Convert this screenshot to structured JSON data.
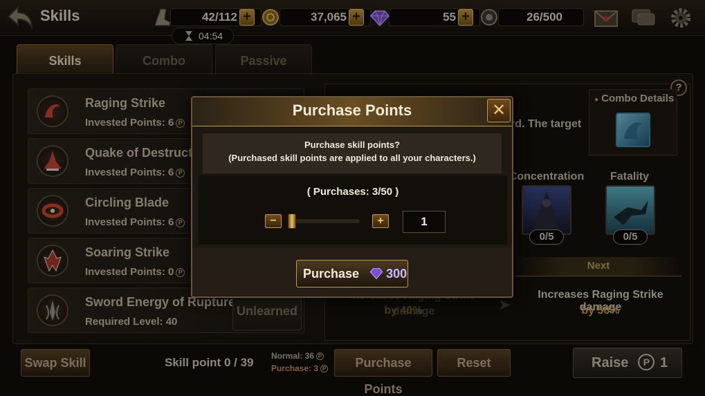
{
  "header": {
    "title": "Skills",
    "stamina": "42/112",
    "gold": "37,065",
    "gems": "55",
    "capacity": "26/500",
    "timer": "04:54"
  },
  "tabs": [
    {
      "label": "Skills",
      "active": true
    },
    {
      "label": "Combo",
      "active": false
    },
    {
      "label": "Passive",
      "active": false
    }
  ],
  "skills": [
    {
      "name": "Raging Strike",
      "sub": "Invested Points:  6",
      "coin": true
    },
    {
      "name": "Quake of Destruction",
      "sub": "Invested Points:  6",
      "coin": true
    },
    {
      "name": "Circling Blade",
      "sub": "Invested Points:  6",
      "coin": true
    },
    {
      "name": "Soaring Strike",
      "sub": "Invested Points:  0",
      "coin": true
    },
    {
      "name": "Sword Energy of Rupture",
      "sub": "Required Level:  40",
      "coin": false
    }
  ],
  "unlearned_label": "Unlearned",
  "detail": {
    "desc_fragment": "rd. The target",
    "combo_details": "Combo Details",
    "passives": [
      {
        "name": "Concentration",
        "count": "0/5"
      },
      {
        "name": "Fatality",
        "count": "0/5"
      }
    ],
    "next_label": "Next",
    "current_text": "ncreases Raging Strike damage",
    "current_value": "by 40%",
    "next_text": "Increases Raging Strike damage",
    "next_value": "by 50%"
  },
  "bottom": {
    "swap_skill": "Swap Skill",
    "skill_point": "Skill point 0 / 39",
    "normal": "Normal: 36",
    "purchase": "Purchase: 3",
    "purchase_points": "Purchase Points",
    "reset": "Reset",
    "raise": "Raise",
    "raise_cost": "1",
    "p_symbol": "P"
  },
  "modal": {
    "title": "Purchase Points",
    "close": "✕",
    "message_line1": "Purchase skill points?",
    "message_line2": "(Purchased skill points are applied to all your characters.)",
    "purchases": "( Purchases: 3/50 )",
    "quantity": "1",
    "purchase_label": "Purchase",
    "price": "300",
    "minus": "−",
    "plus": "+"
  },
  "colors": {
    "accent_gold": "#c79a3a",
    "gem_purple": "#8a5cff",
    "background": "#120e0a"
  }
}
